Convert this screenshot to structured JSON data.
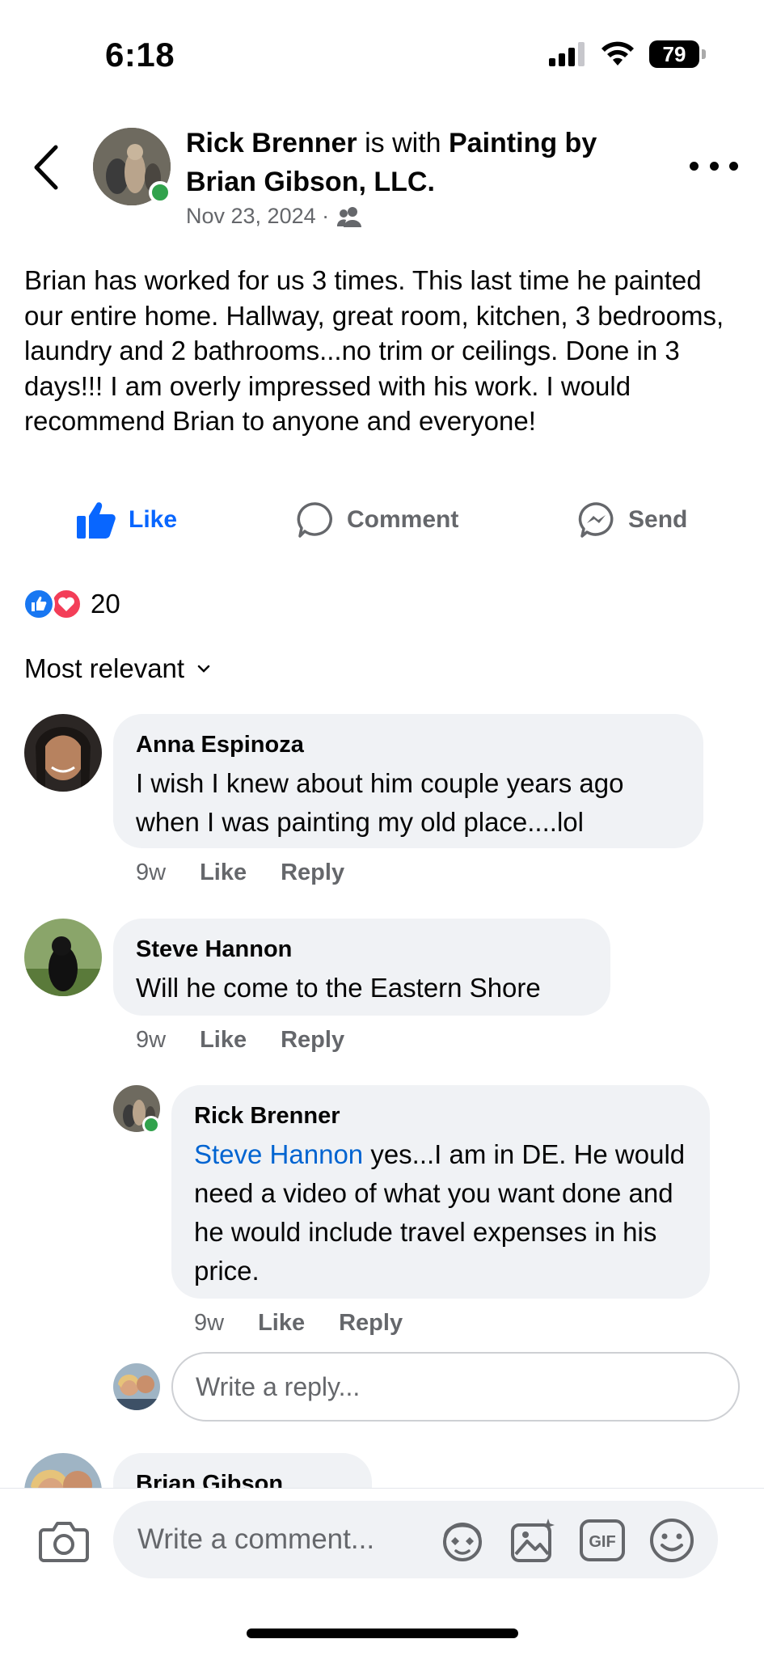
{
  "status_bar": {
    "time": "6:18",
    "battery": "79"
  },
  "post": {
    "author": "Rick Brenner",
    "connector": " is with ",
    "tagged": "Painting by Brian Gibson, LLC.",
    "date": "Nov 23, 2024 ·",
    "body": "Brian has worked for us 3 times. This last time he painted our entire home. Hallway, great room, kitchen, 3 bedrooms, laundry and 2 bathrooms...no trim or ceilings. Done in 3 days!!!  I am overly impressed with his work. I would recommend Brian to anyone and everyone!"
  },
  "actions": {
    "like": "Like",
    "comment": "Comment",
    "send": "Send"
  },
  "reactions": {
    "count": "20"
  },
  "sort": {
    "label": "Most relevant"
  },
  "comments": [
    {
      "author": "Anna Espinoza",
      "text": "I wish I knew about him couple years ago when I was painting my old place....lol",
      "time": "9w",
      "like": "Like",
      "reply": "Reply"
    },
    {
      "author": "Steve Hannon",
      "text": "Will he come to the Eastern Shore",
      "time": "9w",
      "like": "Like",
      "reply": "Reply"
    }
  ],
  "reply": {
    "author": "Rick Brenner",
    "mention": "Steve Hannon",
    "text": " yes...I am in DE. He would need a video of what you want done and he would include travel expenses in his price.",
    "time": "9w",
    "like": "Like",
    "reply": "Reply"
  },
  "reply_box": {
    "placeholder": "Write a reply..."
  },
  "partial_comment": {
    "author": "Brian Gibson"
  },
  "composer": {
    "placeholder": "Write a comment..."
  },
  "colors": {
    "accent": "#0866ff",
    "bubble": "#f0f2f5",
    "muted": "#65676b",
    "online": "#31a24c",
    "love": "#f33e58"
  }
}
